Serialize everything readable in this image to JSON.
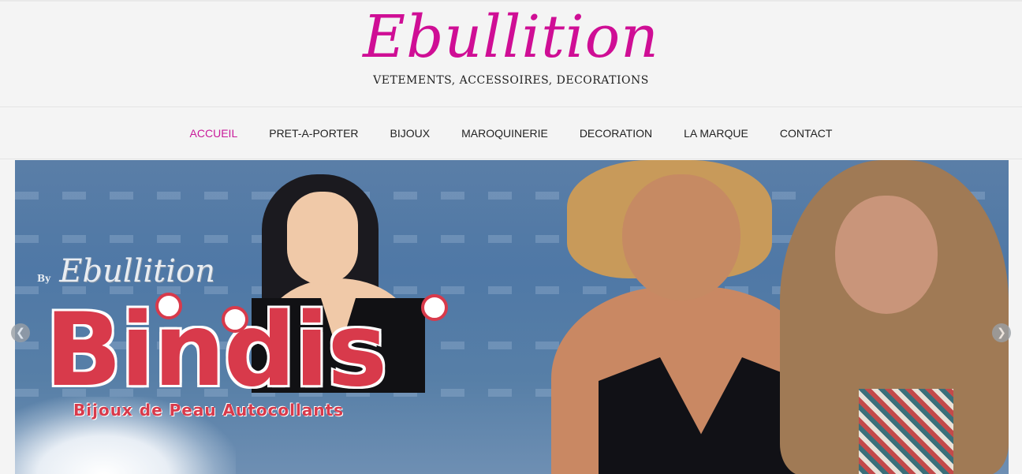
{
  "site": {
    "title": "Ebullition",
    "tagline": "VETEMENTS, ACCESSOIRES, DECORATIONS"
  },
  "nav": {
    "items": [
      {
        "label": "ACCUEIL",
        "active": true
      },
      {
        "label": "PRET-A-PORTER",
        "active": false
      },
      {
        "label": "BIJOUX",
        "active": false
      },
      {
        "label": "MAROQUINERIE",
        "active": false
      },
      {
        "label": "DECORATION",
        "active": false
      },
      {
        "label": "LA MARQUE",
        "active": false
      },
      {
        "label": "CONTACT",
        "active": false
      }
    ]
  },
  "slider": {
    "by_text": "By",
    "brand_text": "Ebullition",
    "headline": "Bindis",
    "subtitle": "Bijoux de Peau Autocollants",
    "prev_icon": "chevron-left-icon",
    "next_icon": "chevron-right-icon"
  },
  "colors": {
    "brand": "#cf0e95",
    "nav_active": "#c81a9a",
    "bindis_red": "#d83a4b"
  }
}
